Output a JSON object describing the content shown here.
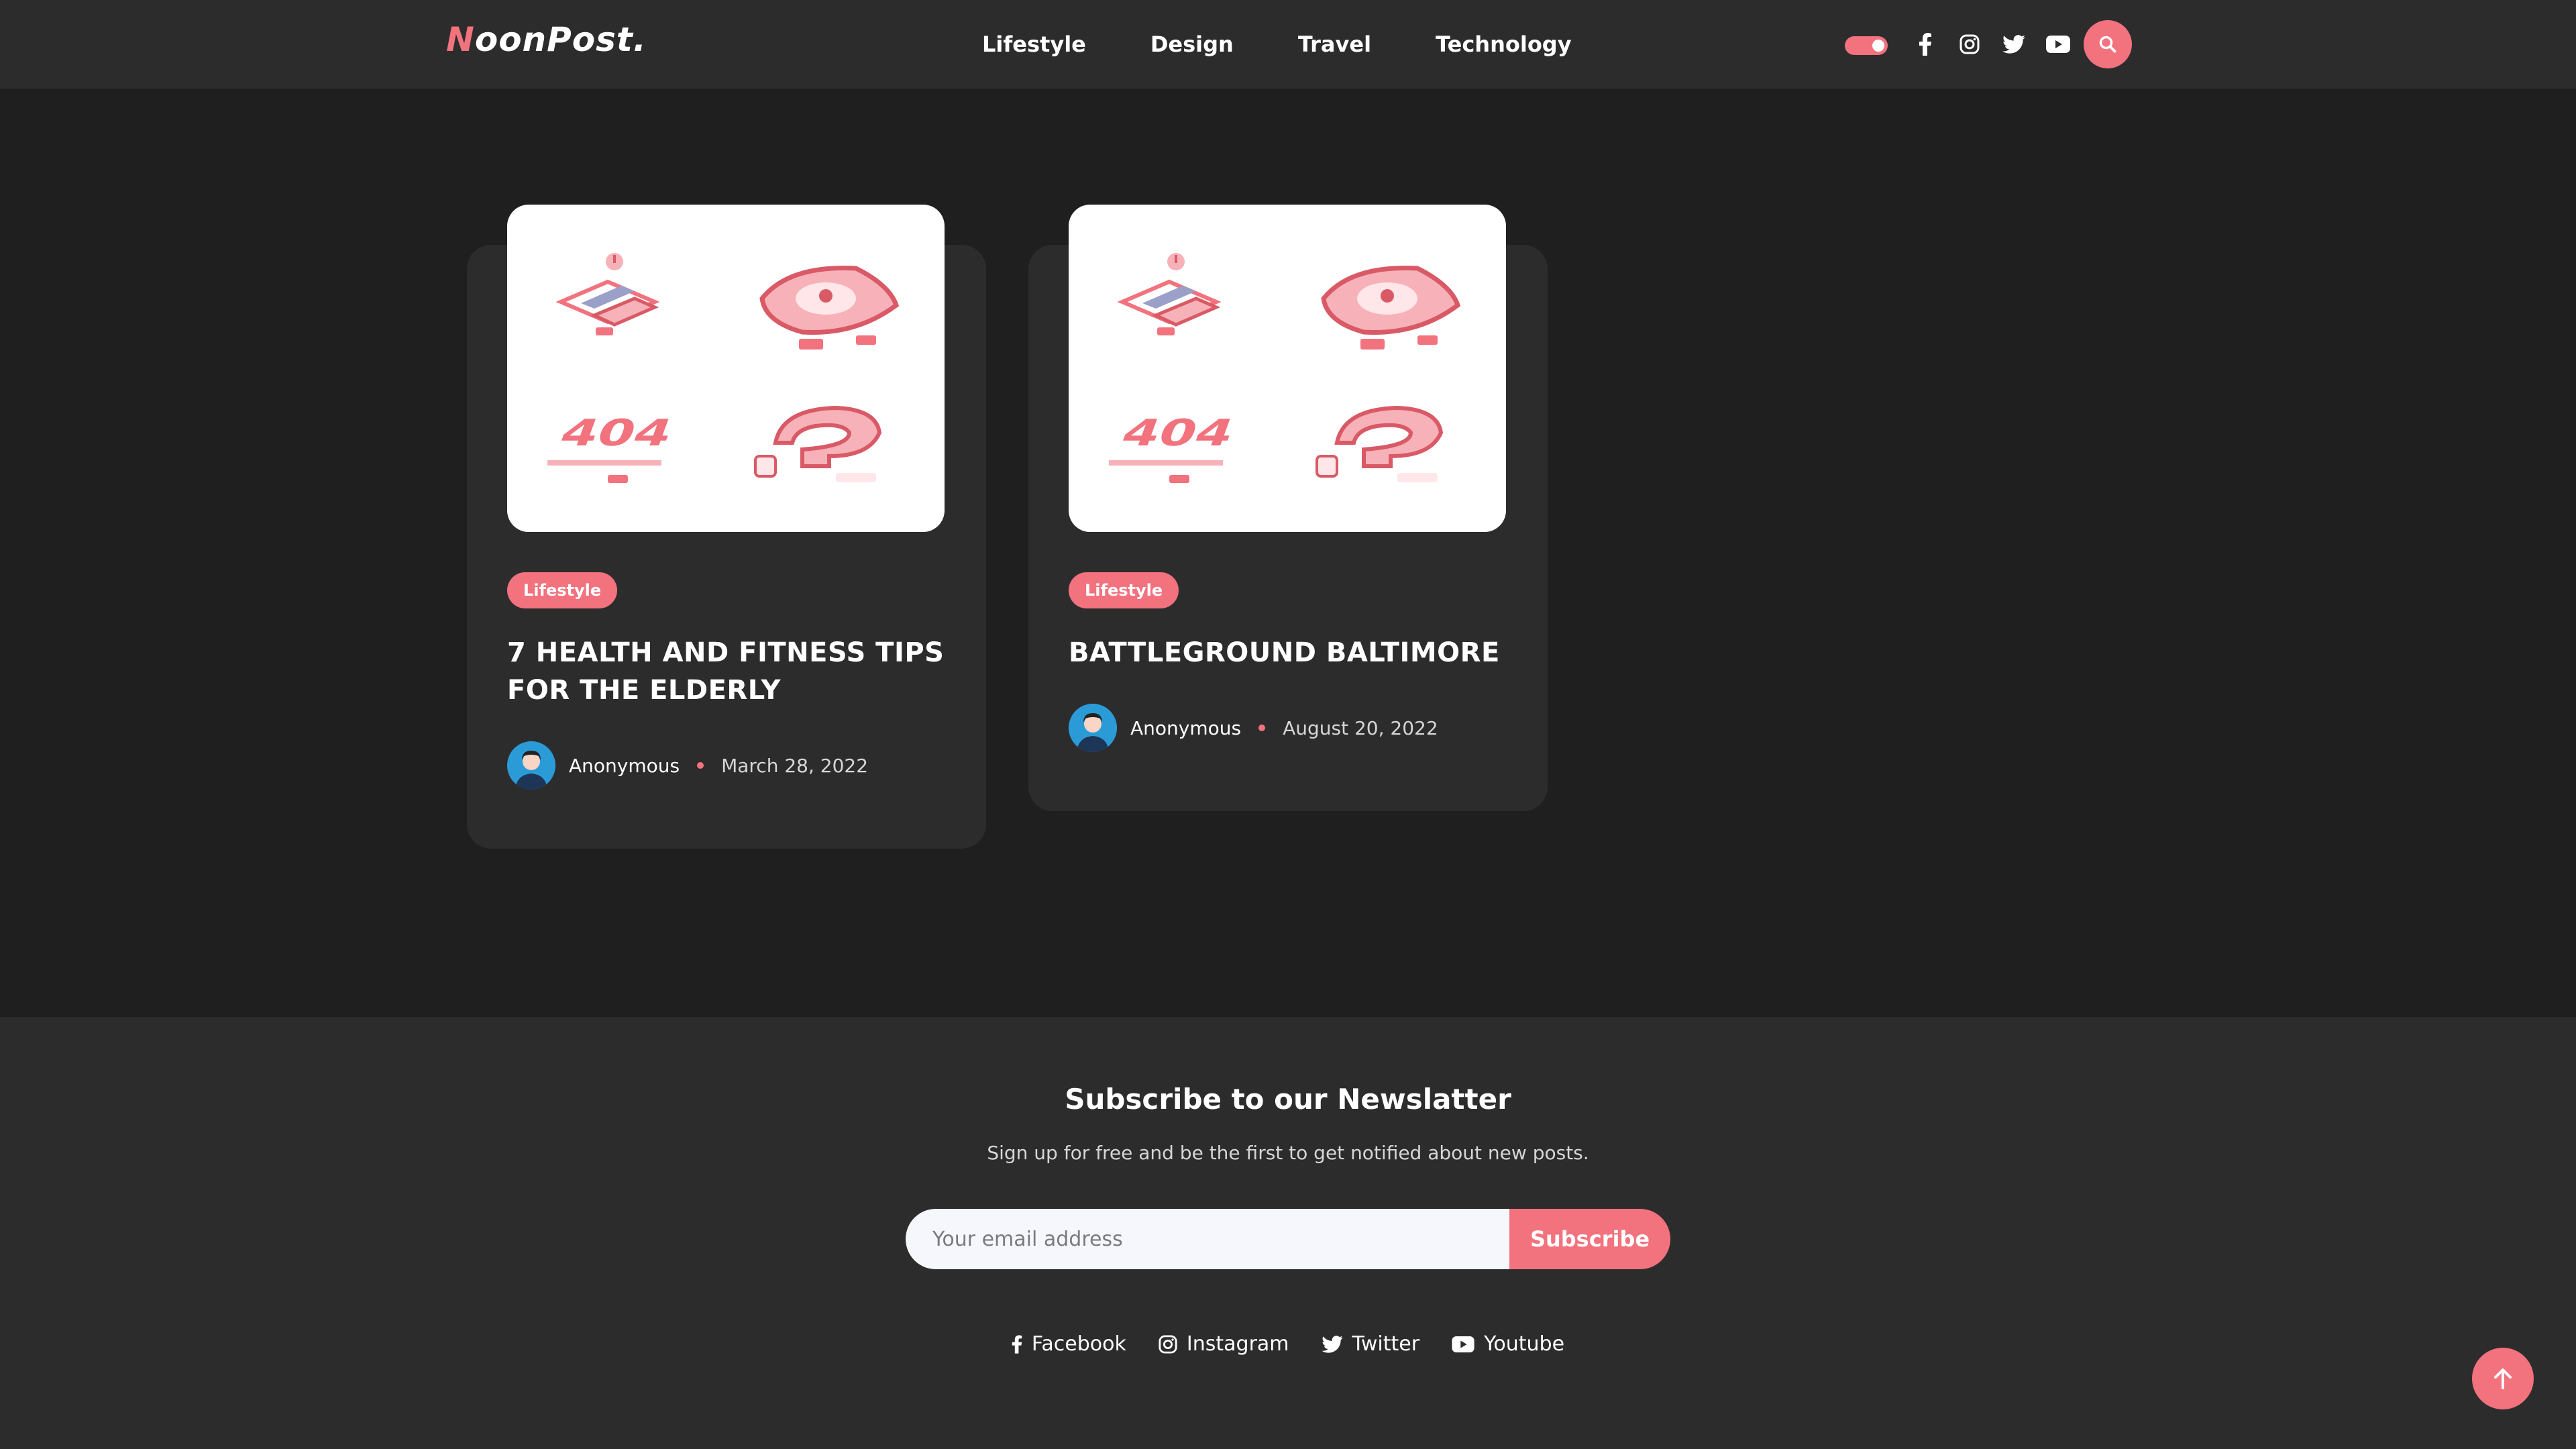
{
  "header": {
    "logo_first": "N",
    "logo_rest": "oonPost.",
    "nav": [
      "Lifestyle",
      "Design",
      "Travel",
      "Technology"
    ],
    "social_icons": [
      "facebook-icon",
      "instagram-icon",
      "twitter-icon",
      "youtube-icon"
    ],
    "search_icon": "search-icon"
  },
  "posts": [
    {
      "tag": "Lifestyle",
      "title": "7 HEALTH AND FITNESS TIPS FOR THE ELDERLY",
      "author": "Anonymous",
      "date": "March 28, 2022"
    },
    {
      "tag": "Lifestyle",
      "title": "BATTLEGROUND BALTIMORE",
      "author": "Anonymous",
      "date": "August 20, 2022"
    }
  ],
  "newsletter": {
    "title": "Subscribe to our Newslatter",
    "subtitle": "Sign up for free and be the first to get notified about new posts.",
    "placeholder": "Your email address",
    "button": "Subscribe"
  },
  "footer_social": [
    {
      "icon": "facebook-icon",
      "label": "Facebook"
    },
    {
      "icon": "instagram-icon",
      "label": "Instagram"
    },
    {
      "icon": "twitter-icon",
      "label": "Twitter"
    },
    {
      "icon": "youtube-icon",
      "label": "Youtube"
    }
  ],
  "colors": {
    "accent": "#f2727e",
    "background": "#1f1f1f",
    "surface": "#2c2c2d"
  }
}
